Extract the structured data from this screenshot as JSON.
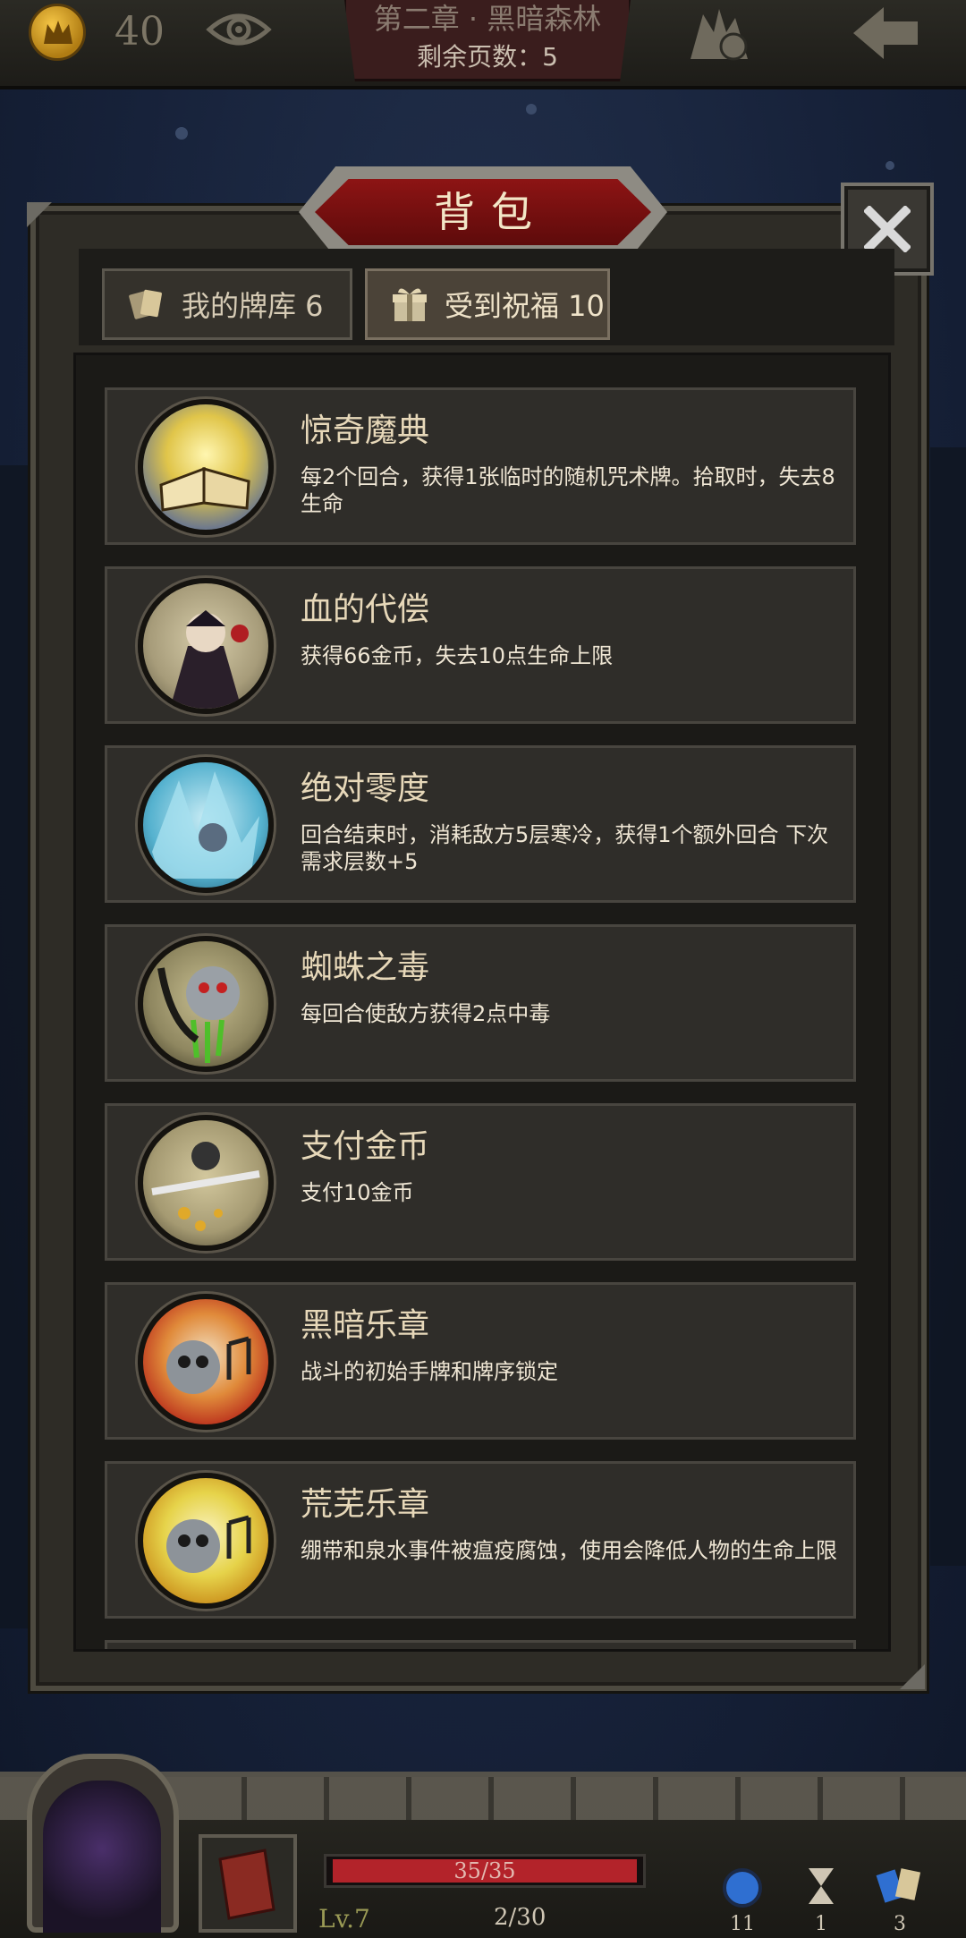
{
  "topbar": {
    "gold": "40",
    "chapter_title": "第二章 · 黑暗森林",
    "pages_remaining": "剩余页数：5"
  },
  "panel": {
    "title": "背包",
    "tabs": [
      {
        "label": "我的牌库 6",
        "icon": "cards-icon",
        "selected": false
      },
      {
        "label": "受到祝福 10",
        "icon": "gift-icon",
        "selected": true
      }
    ],
    "items": [
      {
        "name": "惊奇魔典",
        "desc": "每2个回合，获得1张临时的随机咒术牌。拾取时，失去8生命",
        "icon": "magic-book-icon"
      },
      {
        "name": "血的代偿",
        "desc": "获得66金币，失去10点生命上限",
        "icon": "vampire-icon"
      },
      {
        "name": "绝对零度",
        "desc": "回合结束时，消耗敌方5层寒冷，获得1个额外回合 下次需求层数+5",
        "icon": "ice-crystal-icon"
      },
      {
        "name": "蜘蛛之毒",
        "desc": "每回合使敌方获得2点中毒",
        "icon": "spider-icon"
      },
      {
        "name": "支付金币",
        "desc": "支付10金币",
        "icon": "coin-payment-icon"
      },
      {
        "name": "黑暗乐章",
        "desc": "战斗的初始手牌和牌序锁定",
        "icon": "dark-music-skull-icon"
      },
      {
        "name": "荒芜乐章",
        "desc": "绷带和泉水事件被瘟疫腐蚀，使用会降低人物的生命上限",
        "icon": "barren-music-skull-icon"
      }
    ]
  },
  "hud": {
    "hp": "35/35",
    "hp_fraction": 1.0,
    "level": "Lv.7",
    "xp": "2/30",
    "resources": [
      {
        "icon": "orb-icon",
        "count": "11"
      },
      {
        "icon": "hourglass-icon",
        "count": "1"
      },
      {
        "icon": "card-fan-icon",
        "count": "3"
      }
    ]
  },
  "colors": {
    "accent_red": "#a81b1b",
    "panel": "#2e2c26",
    "item_bg": "#2f2d29",
    "hp_red": "#b3232a"
  }
}
